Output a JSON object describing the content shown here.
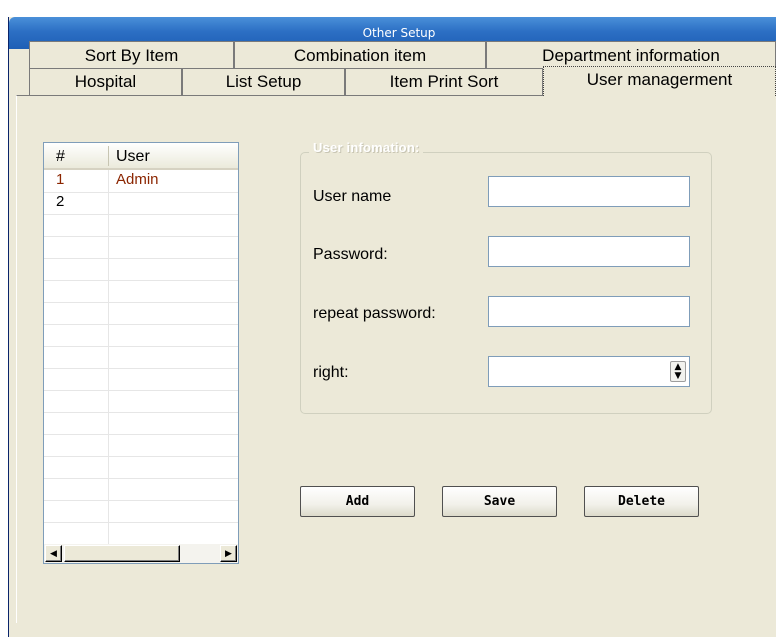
{
  "window": {
    "title": "Other Setup"
  },
  "tabs": {
    "row1": [
      "Sort By Item",
      "Combination item",
      "Department information"
    ],
    "row2": [
      "Hospital",
      "List Setup",
      "Item Print Sort",
      "User managerment"
    ],
    "active": "User managerment"
  },
  "user_list": {
    "columns": [
      "#",
      "User"
    ],
    "rows": [
      {
        "num": "1",
        "user": "Admin",
        "selected": true
      },
      {
        "num": "2",
        "user": ""
      }
    ]
  },
  "user_info": {
    "group_title": "User infomation:",
    "user_name_label": "User name",
    "user_name_value": "",
    "password_label": "Password:",
    "password_value": "",
    "repeat_password_label": "repeat password:",
    "repeat_password_value": "",
    "right_label": "right:",
    "right_value": ""
  },
  "buttons": {
    "add": "Add",
    "save": "Save",
    "delete": "Delete"
  },
  "colors": {
    "titlebar": "#2c6fc4",
    "window_bg": "#ece9d8",
    "selected_row_text": "#8b2500"
  }
}
